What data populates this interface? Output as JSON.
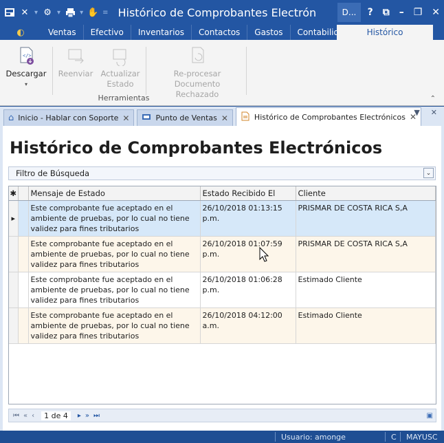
{
  "window": {
    "title": "Histórico de Comprobantes Electrónicos - ...",
    "user_badge": "D...",
    "help": "?",
    "colors": {
      "title_bg": "#2356a3",
      "accent": "#2356a3",
      "selected_row": "#d6e8f9",
      "alt_row": "#fdf6ea"
    }
  },
  "ribbon": {
    "tabs": [
      {
        "label": "Ventas"
      },
      {
        "label": "Efectivo"
      },
      {
        "label": "Inventarios"
      },
      {
        "label": "Contactos"
      },
      {
        "label": "Gastos"
      },
      {
        "label": "Contabilidad"
      }
    ],
    "active_tab": "Histórico",
    "buttons": {
      "descargar": "Descargar",
      "reenviar": "Reenviar",
      "actualizar_1": "Actualizar",
      "actualizar_2": "Estado",
      "reprocesar_1": "Re-procesar",
      "reprocesar_2": "Documento Rechazado"
    },
    "group_label": "Herramientas"
  },
  "doc_tabs": [
    {
      "label": "Inicio - Hablar con Soporte",
      "icon": "home-icon"
    },
    {
      "label": "Punto de Ventas",
      "icon": "pos-icon"
    },
    {
      "label": "Histórico de Comprobantes Electrónicos",
      "icon": "document-icon"
    }
  ],
  "page": {
    "title": "Histórico de Comprobantes Electrónicos",
    "filter_label": "Filtro de Búsqueda"
  },
  "grid": {
    "columns": [
      "Mensaje de Estado",
      "Estado Recibido El",
      "Cliente"
    ],
    "rows": [
      {
        "mensaje": "Este comprobante fue aceptado en el ambiente de pruebas, por lo cual no tiene validez para fines tributarios",
        "fecha": "26/10/2018 01:13:15 p.m.",
        "cliente": "PRISMAR DE COSTA RICA S,A"
      },
      {
        "mensaje": "Este comprobante fue aceptado en el ambiente de pruebas, por lo cual no tiene validez para fines tributarios",
        "fecha": "26/10/2018 01:07:59 p.m.",
        "cliente": "PRISMAR DE COSTA RICA S,A"
      },
      {
        "mensaje": "Este comprobante fue aceptado en el ambiente de pruebas, por lo cual no tiene validez para fines tributarios",
        "fecha": "26/10/2018 01:06:28 p.m.",
        "cliente": "Estimado Cliente"
      },
      {
        "mensaje": "Este comprobante fue aceptado en el ambiente de pruebas, por lo cual no tiene validez para fines tributarios",
        "fecha": "26/10/2018 04:12:00 a.m.",
        "cliente": "Estimado Cliente"
      }
    ]
  },
  "pager": {
    "page_text": "1 de 4"
  },
  "statusbar": {
    "usuario": "Usuario: amonge",
    "c": "C",
    "mayusc": "MAYUSC"
  }
}
